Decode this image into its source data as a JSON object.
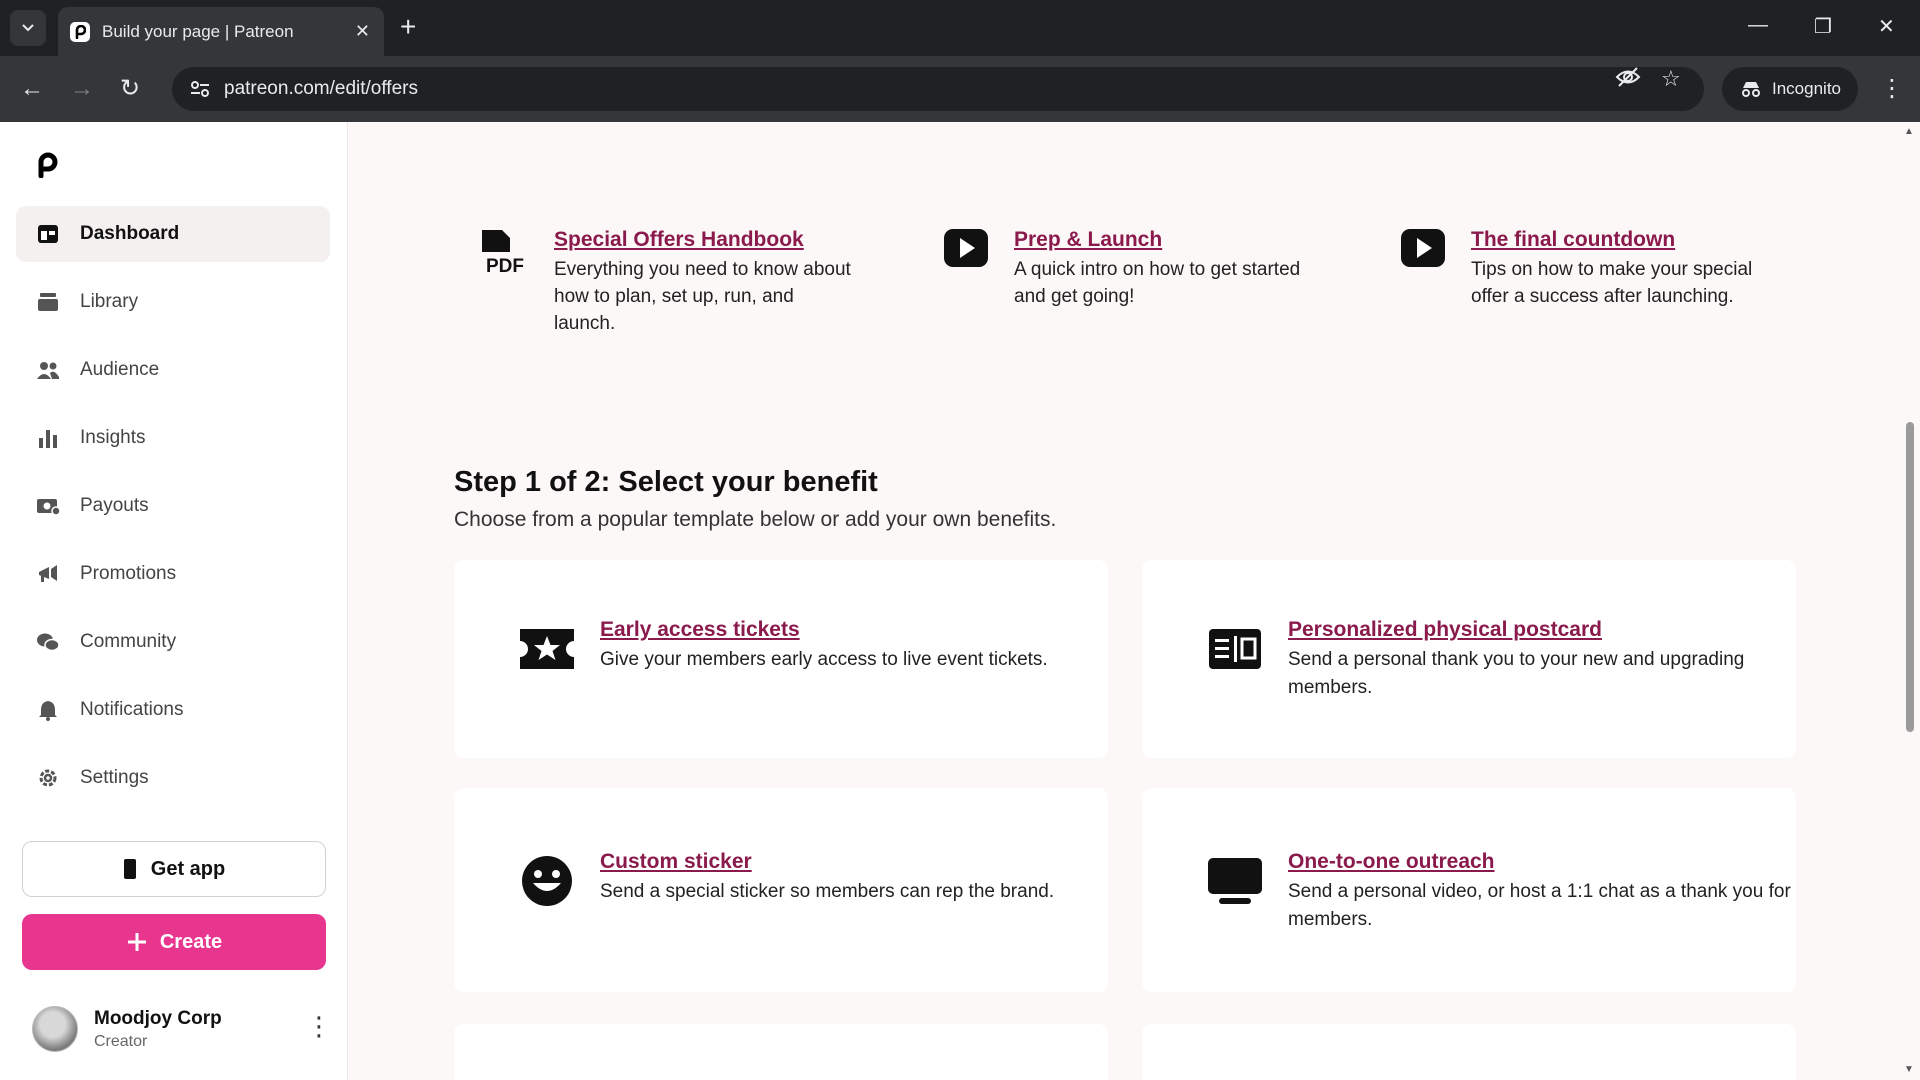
{
  "browser": {
    "tab_title": "Build your page | Patreon",
    "url": "patreon.com/edit/offers",
    "incognito_label": "Incognito"
  },
  "sidebar": {
    "items": [
      {
        "label": "Dashboard",
        "icon": "dashboard-icon"
      },
      {
        "label": "Library",
        "icon": "library-icon"
      },
      {
        "label": "Audience",
        "icon": "audience-icon"
      },
      {
        "label": "Insights",
        "icon": "insights-icon"
      },
      {
        "label": "Payouts",
        "icon": "payouts-icon"
      },
      {
        "label": "Promotions",
        "icon": "promotions-icon"
      },
      {
        "label": "Community",
        "icon": "community-icon"
      },
      {
        "label": "Notifications",
        "icon": "bell-icon"
      },
      {
        "label": "Settings",
        "icon": "gear-icon"
      }
    ],
    "get_app": "Get app",
    "create": "Create",
    "user": {
      "name": "Moodjoy Corp",
      "role": "Creator"
    }
  },
  "resources": [
    {
      "title": "Special Offers Handbook",
      "desc": "Everything you need to know about how to plan, set up, run, and launch.",
      "icon": "pdf-icon"
    },
    {
      "title": "Prep & Launch",
      "desc": "A quick intro on how to get started and get going!",
      "icon": "play-icon"
    },
    {
      "title": "The final countdown",
      "desc": "Tips on how to make your special offer a success after launching.",
      "icon": "play-icon"
    }
  ],
  "step": {
    "title": "Step 1 of 2: Select your benefit",
    "subtitle": "Choose from a popular template below or add your own benefits."
  },
  "benefits": [
    {
      "title": "Early access tickets",
      "desc": "Give your members early access to live event tickets.",
      "icon": "ticket-star-icon"
    },
    {
      "title": "Personalized physical postcard",
      "desc": "Send a personal thank you to your new and upgrading members.",
      "icon": "postcard-icon"
    },
    {
      "title": "Custom sticker",
      "desc": "Send a special sticker so members can rep the brand.",
      "icon": "smiley-sticker-icon"
    },
    {
      "title": "One-to-one outreach",
      "desc": "Send a personal video, or host a 1:1 chat as a thank you for members.",
      "icon": "monitor-icon"
    }
  ],
  "colors": {
    "accent": "#e8368f",
    "link": "#8b1a4c"
  }
}
